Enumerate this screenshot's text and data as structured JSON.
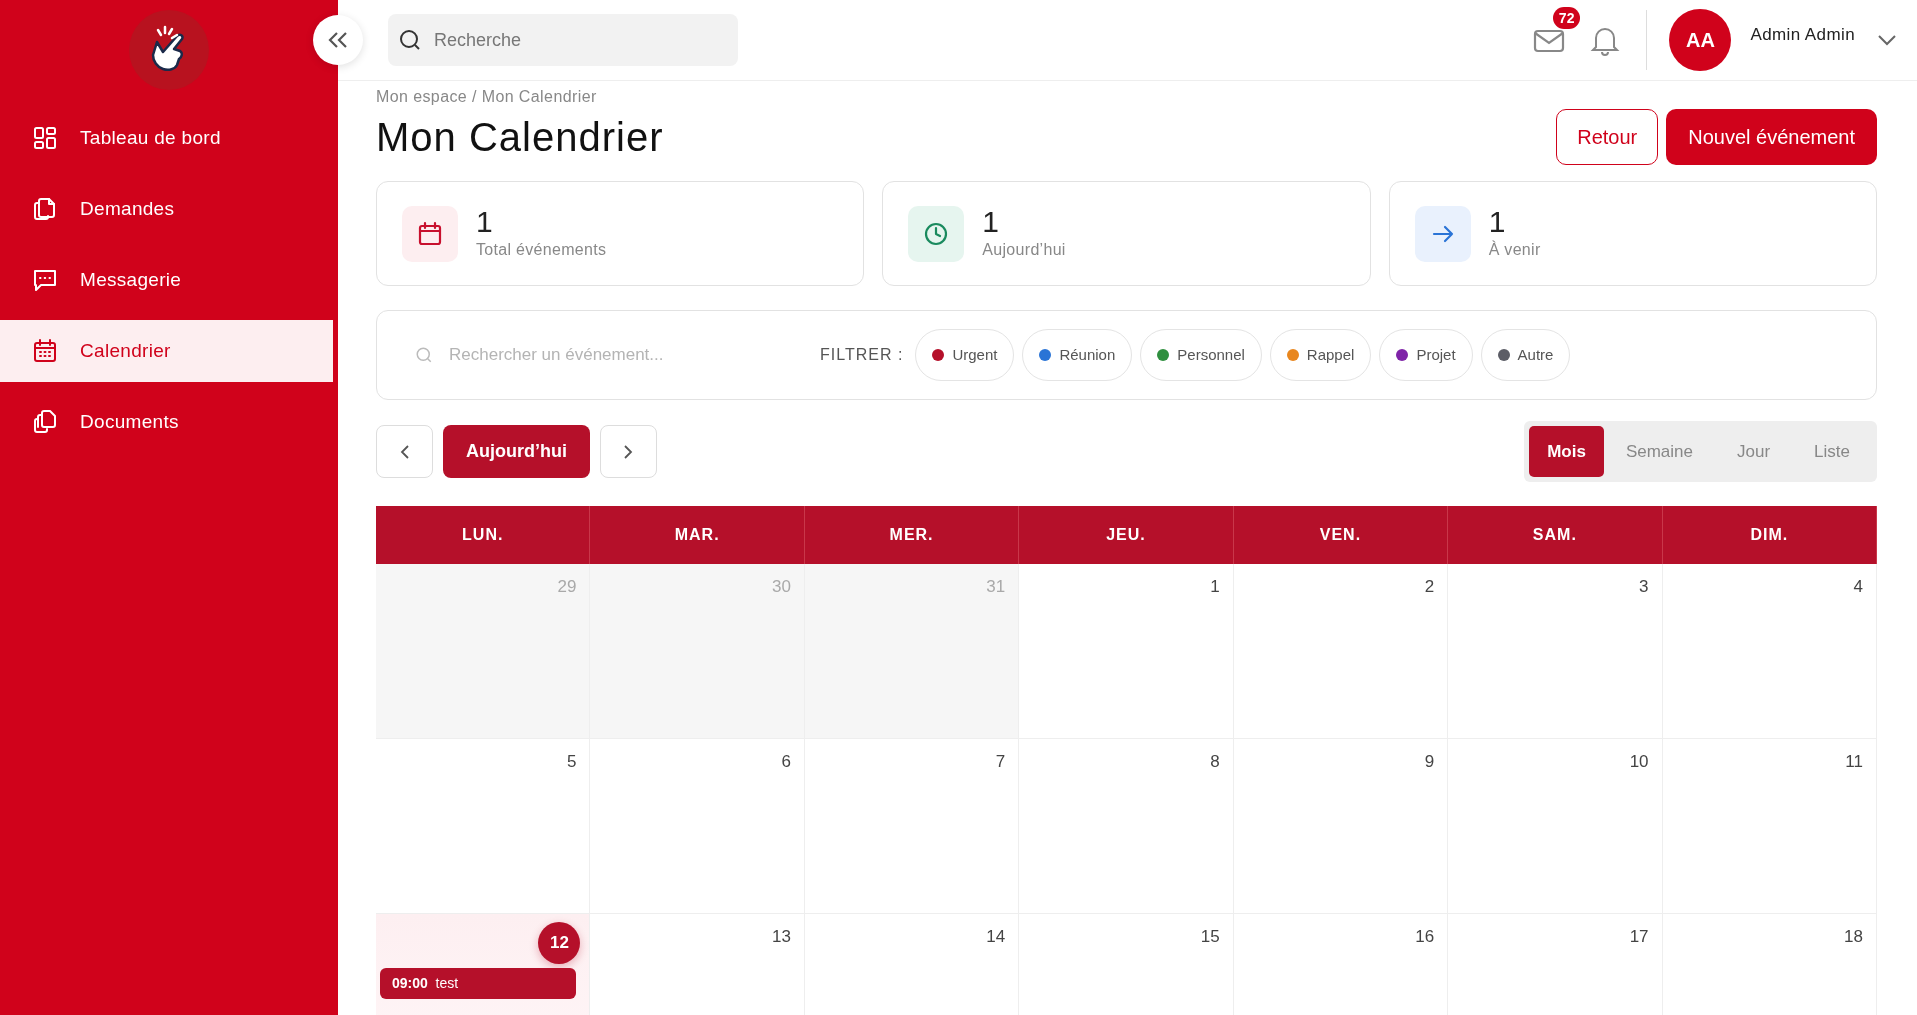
{
  "sidebar": {
    "items": [
      {
        "label": "Tableau de bord",
        "selected": false
      },
      {
        "label": "Demandes",
        "selected": false
      },
      {
        "label": "Messagerie",
        "selected": false
      },
      {
        "label": "Calendrier",
        "selected": true
      },
      {
        "label": "Documents",
        "selected": false
      }
    ]
  },
  "topbar": {
    "search": {
      "placeholder": "Recherche"
    },
    "mail_badge": "72",
    "user": {
      "initials": "AA",
      "name": "Admin Admin"
    }
  },
  "breadcrumb": "Mon espace / Mon Calendrier",
  "title": "Mon Calendrier",
  "actions": [
    {
      "label": "Retour",
      "kind": "outline"
    },
    {
      "label": "Nouvel événement",
      "kind": "primary"
    }
  ],
  "stats": [
    {
      "value": "1",
      "label": "Total événements",
      "kind": "total"
    },
    {
      "value": "1",
      "label": "Aujourd’hui",
      "kind": "today"
    },
    {
      "value": "1",
      "label": "À venir",
      "kind": "upcoming"
    }
  ],
  "filter_bar": {
    "search": {
      "placeholder": "Rechercher un événement..."
    },
    "label": "FILTRER :",
    "filters": [
      {
        "label": "Urgent",
        "color": "#b5102a"
      },
      {
        "label": "Réunion",
        "color": "#2a74d6"
      },
      {
        "label": "Personnel",
        "color": "#2f8f3f"
      },
      {
        "label": "Rappel",
        "color": "#e8861e"
      },
      {
        "label": "Projet",
        "color": "#7f24a8"
      },
      {
        "label": "Autre",
        "color": "#5c5d66"
      }
    ]
  },
  "navigation": {
    "today_label": "Aujourd’hui"
  },
  "views": [
    {
      "label": "Mois",
      "selected": true
    },
    {
      "label": "Semaine",
      "selected": false
    },
    {
      "label": "Jour",
      "selected": false
    },
    {
      "label": "Liste",
      "selected": false
    }
  ],
  "weekdays": [
    "LUN.",
    "MAR.",
    "MER.",
    "JEU.",
    "VEN.",
    "SAM.",
    "DIM."
  ],
  "weeks": [
    [
      {
        "day": "29",
        "outside": true,
        "today": false
      },
      {
        "day": "30",
        "outside": true,
        "today": false
      },
      {
        "day": "31",
        "outside": true,
        "today": false
      },
      {
        "day": "1",
        "outside": false,
        "today": false
      },
      {
        "day": "2",
        "outside": false,
        "today": false
      },
      {
        "day": "3",
        "outside": false,
        "today": false
      },
      {
        "day": "4",
        "outside": false,
        "today": false
      }
    ],
    [
      {
        "day": "5",
        "outside": false,
        "today": false
      },
      {
        "day": "6",
        "outside": false,
        "today": false
      },
      {
        "day": "7",
        "outside": false,
        "today": false
      },
      {
        "day": "8",
        "outside": false,
        "today": false
      },
      {
        "day": "9",
        "outside": false,
        "today": false
      },
      {
        "day": "10",
        "outside": false,
        "today": false
      },
      {
        "day": "11",
        "outside": false,
        "today": false
      }
    ],
    [
      {
        "day": "12",
        "outside": false,
        "today": true,
        "events": [
          {
            "time": "09:00",
            "title": "test"
          }
        ]
      },
      {
        "day": "13",
        "outside": false,
        "today": false
      },
      {
        "day": "14",
        "outside": false,
        "today": false
      },
      {
        "day": "15",
        "outside": false,
        "today": false
      },
      {
        "day": "16",
        "outside": false,
        "today": false
      },
      {
        "day": "17",
        "outside": false,
        "today": false
      },
      {
        "day": "18",
        "outside": false,
        "today": false
      }
    ]
  ]
}
